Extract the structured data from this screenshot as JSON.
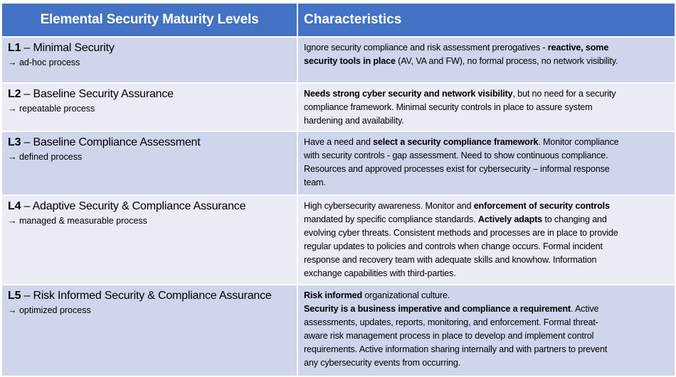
{
  "header": {
    "levels_title": "Elemental Security Maturity Levels",
    "characteristics_title": "Characteristics"
  },
  "colors": {
    "header_bg": "#4472C4",
    "header_text": "#FFFFFF",
    "row_dark": "#CFD5EA",
    "row_light": "#E9EBF5",
    "grid": "#FFFFFF"
  },
  "rows": [
    {
      "code": "L1",
      "name": " – Minimal Security",
      "process": "→ ad-hoc process",
      "lines": [
        [
          {
            "t": "Ignore security compliance and risk assessment prerogatives - ",
            "b": false
          },
          {
            "t": "reactive, some",
            "b": true
          }
        ],
        [
          {
            "t": "security tools in place",
            "b": true
          },
          {
            "t": " (AV, VA and FW), no formal process, no network visibility.",
            "b": false
          }
        ]
      ]
    },
    {
      "code": "L2",
      "name": " – Baseline Security Assurance",
      "process": "→ repeatable process",
      "lines": [
        [
          {
            "t": "Needs strong cyber security and network visibility",
            "b": true
          },
          {
            "t": ", but no need for a security",
            "b": false
          }
        ],
        [
          {
            "t": "compliance framework.  Minimal security controls in place to assure system",
            "b": false
          }
        ],
        [
          {
            "t": "hardening and availability.",
            "b": false
          }
        ]
      ]
    },
    {
      "code": "L3",
      "name": " – Baseline Compliance Assessment",
      "process": "→ defined process",
      "lines": [
        [
          {
            "t": "Have a need and ",
            "b": false
          },
          {
            "t": "select a security compliance framework",
            "b": true
          },
          {
            "t": ". Monitor compliance",
            "b": false
          }
        ],
        [
          {
            "t": "with security controls - gap assessment. Need to show continuous compliance.",
            "b": false
          }
        ],
        [
          {
            "t": "Resources and approved processes exist for cybersecurity – informal response",
            "b": false
          }
        ],
        [
          {
            "t": "team.",
            "b": false
          }
        ]
      ]
    },
    {
      "code": "L4",
      "name": " – Adaptive Security & Compliance Assurance",
      "process": "→ managed & measurable process",
      "lines": [
        [
          {
            "t": "High cybersecurity awareness. Monitor and ",
            "b": false
          },
          {
            "t": "enforcement of security controls",
            "b": true
          }
        ],
        [
          {
            "t": "mandated by specific compliance standards. ",
            "b": false
          },
          {
            "t": "Actively adapts",
            "b": true
          },
          {
            "t": " to changing and",
            "b": false
          }
        ],
        [
          {
            "t": "evolving cyber threats. Consistent methods and processes are in place to provide",
            "b": false
          }
        ],
        [
          {
            "t": "regular updates to policies and controls when change occurs. Formal incident",
            "b": false
          }
        ],
        [
          {
            "t": "response and recovery team with adequate skills and knowhow.  Information",
            "b": false
          }
        ],
        [
          {
            "t": "exchange capabilities with third-parties.",
            "b": false
          }
        ]
      ]
    },
    {
      "code": "L5",
      "name": " – Risk Informed Security & Compliance Assurance",
      "process": "→ optimized process",
      "lines": [
        [
          {
            "t": "Risk informed",
            "b": true
          },
          {
            "t": " organizational culture.",
            "b": false
          }
        ],
        [
          {
            "t": "Security is a business imperative and compliance a requirement",
            "b": true
          },
          {
            "t": ". Active",
            "b": false
          }
        ],
        [
          {
            "t": "assessments, updates, reports, monitoring,  and enforcement. Formal threat-",
            "b": false
          }
        ],
        [
          {
            "t": "aware risk management process in place to develop and implement control",
            "b": false
          }
        ],
        [
          {
            "t": "requirements. Active information sharing internally and with partners to prevent",
            "b": false
          }
        ],
        [
          {
            "t": "any cybersecurity events from occurring.",
            "b": false
          }
        ]
      ]
    }
  ]
}
